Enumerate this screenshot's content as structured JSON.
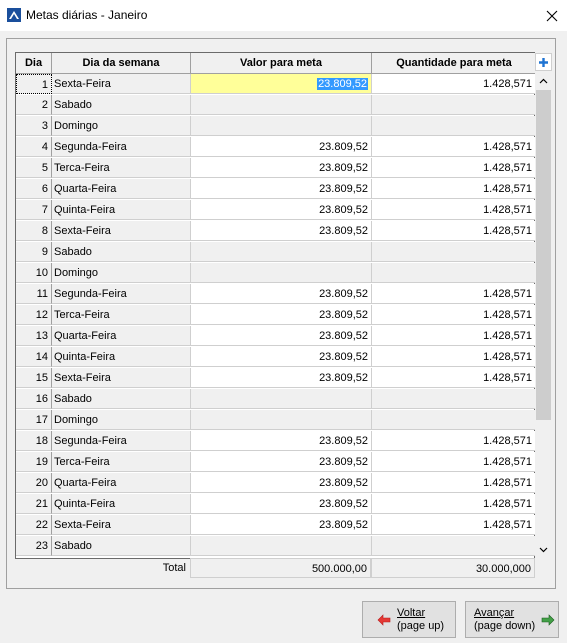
{
  "window": {
    "title": "Metas diárias - Janeiro",
    "close_glyph": "✕"
  },
  "table": {
    "headers": {
      "dia": "Dia",
      "dia_semana": "Dia da semana",
      "valor": "Valor para meta",
      "quantidade": "Quantidade para meta"
    },
    "rows": [
      {
        "dia": "1",
        "dia_semana": "Sexta-Feira",
        "valor": "23.809,52",
        "quantidade": "1.428,571"
      },
      {
        "dia": "2",
        "dia_semana": "Sabado",
        "valor": "",
        "quantidade": ""
      },
      {
        "dia": "3",
        "dia_semana": "Domingo",
        "valor": "",
        "quantidade": ""
      },
      {
        "dia": "4",
        "dia_semana": "Segunda-Feira",
        "valor": "23.809,52",
        "quantidade": "1.428,571"
      },
      {
        "dia": "5",
        "dia_semana": "Terca-Feira",
        "valor": "23.809,52",
        "quantidade": "1.428,571"
      },
      {
        "dia": "6",
        "dia_semana": "Quarta-Feira",
        "valor": "23.809,52",
        "quantidade": "1.428,571"
      },
      {
        "dia": "7",
        "dia_semana": "Quinta-Feira",
        "valor": "23.809,52",
        "quantidade": "1.428,571"
      },
      {
        "dia": "8",
        "dia_semana": "Sexta-Feira",
        "valor": "23.809,52",
        "quantidade": "1.428,571"
      },
      {
        "dia": "9",
        "dia_semana": "Sabado",
        "valor": "",
        "quantidade": ""
      },
      {
        "dia": "10",
        "dia_semana": "Domingo",
        "valor": "",
        "quantidade": ""
      },
      {
        "dia": "11",
        "dia_semana": "Segunda-Feira",
        "valor": "23.809,52",
        "quantidade": "1.428,571"
      },
      {
        "dia": "12",
        "dia_semana": "Terca-Feira",
        "valor": "23.809,52",
        "quantidade": "1.428,571"
      },
      {
        "dia": "13",
        "dia_semana": "Quarta-Feira",
        "valor": "23.809,52",
        "quantidade": "1.428,571"
      },
      {
        "dia": "14",
        "dia_semana": "Quinta-Feira",
        "valor": "23.809,52",
        "quantidade": "1.428,571"
      },
      {
        "dia": "15",
        "dia_semana": "Sexta-Feira",
        "valor": "23.809,52",
        "quantidade": "1.428,571"
      },
      {
        "dia": "16",
        "dia_semana": "Sabado",
        "valor": "",
        "quantidade": ""
      },
      {
        "dia": "17",
        "dia_semana": "Domingo",
        "valor": "",
        "quantidade": ""
      },
      {
        "dia": "18",
        "dia_semana": "Segunda-Feira",
        "valor": "23.809,52",
        "quantidade": "1.428,571"
      },
      {
        "dia": "19",
        "dia_semana": "Terca-Feira",
        "valor": "23.809,52",
        "quantidade": "1.428,571"
      },
      {
        "dia": "20",
        "dia_semana": "Quarta-Feira",
        "valor": "23.809,52",
        "quantidade": "1.428,571"
      },
      {
        "dia": "21",
        "dia_semana": "Quinta-Feira",
        "valor": "23.809,52",
        "quantidade": "1.428,571"
      },
      {
        "dia": "22",
        "dia_semana": "Sexta-Feira",
        "valor": "23.809,52",
        "quantidade": "1.428,571"
      },
      {
        "dia": "23",
        "dia_semana": "Sabado",
        "valor": "",
        "quantidade": ""
      }
    ],
    "total_label": "Total",
    "total_valor": "500.000,00",
    "total_quantidade": "30.000,000"
  },
  "buttons": {
    "voltar_line1": "Voltar",
    "voltar_line2": "(page up)",
    "avancar_line1": "Avançar",
    "avancar_line2": "(page down)"
  },
  "colors": {
    "editing_cell": "#ffff99",
    "selection": "#3399ff",
    "back_arrow": "#e53935",
    "forward_arrow": "#43a047",
    "add_button": "#1e73d2"
  }
}
